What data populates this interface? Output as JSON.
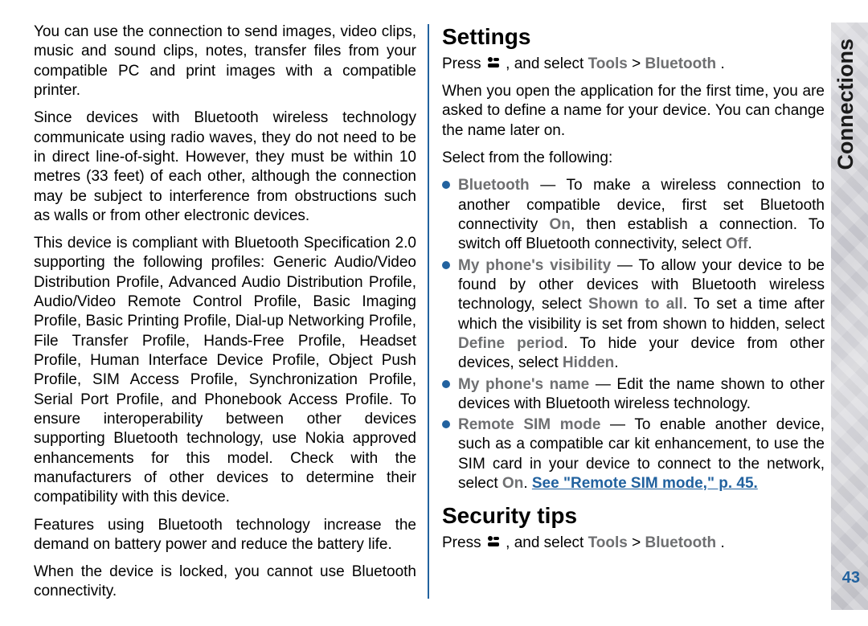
{
  "sidebar": {
    "label": "Connections",
    "page_number": "43"
  },
  "left": {
    "p1": "You can use the connection to send images, video clips, music and sound clips, notes, transfer files from your compatible PC and print images with a compatible printer.",
    "p2": "Since devices with Bluetooth wireless technology communicate using radio waves, they do not need to be in direct line-of-sight. However, they must be within 10 metres (33 feet) of each other, although the connection may be subject to interference from obstructions such as walls or from other electronic devices.",
    "p3": "This device is compliant with Bluetooth Specification 2.0 supporting the following profiles: Generic Audio/Video Distribution Profile, Advanced Audio Distribution Profile, Audio/Video Remote Control Profile, Basic Imaging Profile, Basic Printing Profile, Dial-up Networking Profile, File Transfer Profile, Hands-Free Profile, Headset Profile, Human Interface Device Profile, Object Push Profile, SIM Access Profile, Synchronization Profile, Serial Port Profile, and Phonebook Access Profile. To ensure interoperability between other devices supporting Bluetooth technology, use Nokia approved enhancements for this model. Check with the manufacturers of other devices to determine their compatibility with this device.",
    "p4": "Features using Bluetooth technology increase the demand on battery power and reduce the battery life.",
    "p5": "When the device is locked, you cannot use Bluetooth connectivity."
  },
  "right": {
    "h_settings": "Settings",
    "press_prefix": "Press ",
    "press_mid": " , and select ",
    "press_tools": "Tools",
    "press_gt": " > ",
    "press_bt": "Bluetooth",
    "press_end": ".",
    "settings_p1": "When you open the application for the first time, you are asked to define a name for your device. You can change the name later on.",
    "settings_p2": "Select from the following:",
    "items": [
      {
        "term": "Bluetooth",
        "dash": " — ",
        "body_a": "To make a wireless connection to another compatible device, first set Bluetooth connectivity ",
        "k1": "On",
        "body_b": ", then establish a connection. To switch off Bluetooth connectivity, select ",
        "k2": "Off",
        "body_c": "."
      },
      {
        "term": "My phone's visibility",
        "dash": " — ",
        "body_a": "To allow your device to be found by other devices with Bluetooth wireless technology, select ",
        "k1": "Shown to all",
        "body_b": ". To set a time after which the visibility is set from shown to hidden, select ",
        "k2": "Define period",
        "body_c": ". To hide your device from other devices, select ",
        "k3": "Hidden",
        "body_d": "."
      },
      {
        "term": "My phone's name",
        "dash": " — ",
        "body_a": "Edit the name shown to other devices with Bluetooth wireless technology."
      },
      {
        "term": "Remote SIM mode",
        "dash": " — ",
        "body_a": "To enable another device, such as a compatible car kit enhancement, to use the SIM card in your device to connect to the network, select ",
        "k1": "On",
        "body_b": ". ",
        "link": "See \"Remote SIM mode,\" p. 45."
      }
    ],
    "h_security": "Security tips"
  }
}
